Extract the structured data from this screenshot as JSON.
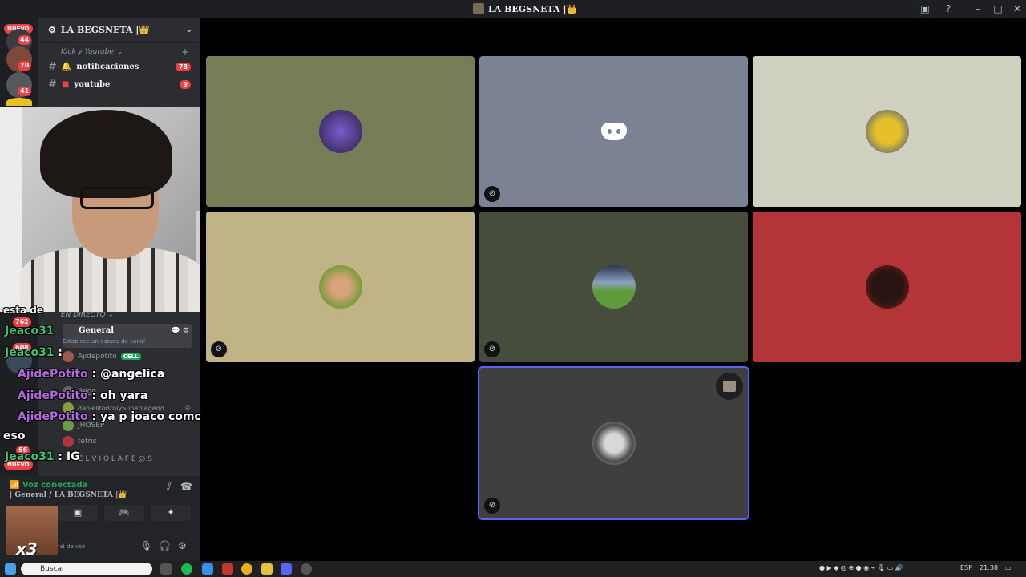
{
  "titlebar": {
    "title": "LA BEGSNETA |👑"
  },
  "servers": {
    "nuevo": "NUEVO",
    "badges": [
      "44",
      "70",
      "41"
    ],
    "lower_badges": [
      "762",
      "608",
      "66"
    ],
    "lower_nuevo": "NUEVO"
  },
  "sidebar": {
    "server_name": "LA BEGSNETA |👑",
    "category": "Kick y Youtube",
    "channels": [
      {
        "label": "notificaciones",
        "badge": "78"
      },
      {
        "label": "youtube",
        "badge": "9"
      }
    ],
    "live_category": "EN DIRECTO",
    "voice_channel": {
      "name": "General",
      "status": "Establece un estado de canal"
    },
    "voice_users": [
      {
        "name": "Ajidepotito",
        "tag": "CELL"
      },
      {
        "name": "Bego"
      },
      {
        "name": "danielitoBrolySuperLegend..."
      },
      {
        "name": "JHOSEP"
      },
      {
        "name": "tetris"
      },
      {
        "name": "E L V I O L A F E @ S"
      }
    ]
  },
  "voice_panel": {
    "status": "Voz conectada",
    "location": "| General / LA BEGSNETA |👑",
    "user_subtext": "nal de voz",
    "overlay_text": "x3"
  },
  "chat": [
    {
      "user": "Jeaco31",
      "text": "",
      "user_color": "#3ec46d"
    },
    {
      "user": "Jeaco31",
      "text": " :",
      "user_color": "#3ec46d"
    },
    {
      "user": "AjidePotito",
      "text": " : @angelica",
      "user_color": "#b566e0"
    },
    {
      "user": "AjidePotito",
      "text": " : oh yara",
      "user_color": "#b566e0"
    },
    {
      "user": "AjidePotito",
      "text": " : ya p joaco como vas a decir",
      "user_color": "#b566e0"
    },
    {
      "user": "",
      "text": "eso",
      "user_color": "#ffffff"
    },
    {
      "user": "Jeaco31",
      "text": " : IG",
      "user_color": "#3ec46d"
    }
  ],
  "chat_partial": "esta de",
  "stage": {
    "tiles": [
      {
        "name": "tile-1",
        "bg": "#767d57",
        "avatar": "#5b3fa0",
        "muted": false
      },
      {
        "name": "tile-2",
        "bg": "#7b8293",
        "avatar": "discord",
        "muted": true
      },
      {
        "name": "tile-3",
        "bg": "#cfd0c0",
        "avatar": "#e6c02a",
        "muted": false
      },
      {
        "name": "tile-4",
        "bg": "#c0b385",
        "avatar": "#8a9c3a",
        "muted": true
      },
      {
        "name": "tile-5",
        "bg": "#464d3c",
        "avatar": "#6a9b4c",
        "muted": true
      },
      {
        "name": "tile-6",
        "bg": "#b43537",
        "avatar": "#2a1412",
        "muted": false
      },
      {
        "name": "tile-7",
        "bg": "#3f3f3f",
        "avatar": "#8e8e8e",
        "muted": true,
        "selected": true
      }
    ]
  },
  "taskbar": {
    "search_placeholder": "Buscar",
    "lang": "ESP",
    "time": "21:38"
  }
}
